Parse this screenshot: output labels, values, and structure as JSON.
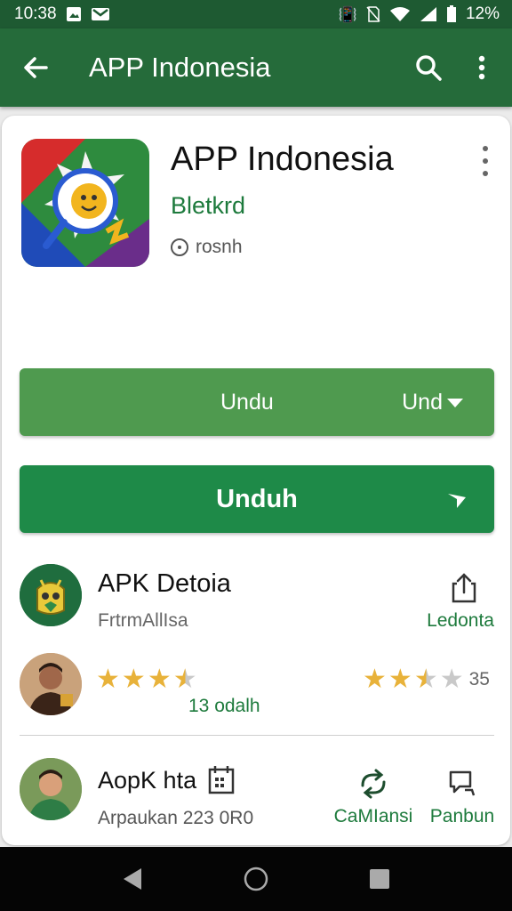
{
  "status": {
    "time": "10:38",
    "battery": "12%",
    "left_icons": [
      "image-notification-icon",
      "gmail-icon"
    ],
    "right_icons": [
      "vibrate-icon",
      "no-sim-icon",
      "wifi-icon",
      "signal-icon",
      "battery-icon"
    ]
  },
  "appbar": {
    "title": "APP Indonesia",
    "icons": [
      "back-arrow-icon",
      "search-icon",
      "more-vert-icon"
    ]
  },
  "app": {
    "title": "APP Indonesia",
    "developer": "Bletkrd",
    "meta": "rosnh"
  },
  "buttons": {
    "primary_label": "Undu",
    "primary_dropdown": "Und",
    "secondary_label": "Unduh"
  },
  "related": {
    "title": "APK Detoia",
    "subtitle": "FrtrmAllIsa",
    "link": "Ledonta"
  },
  "rating": {
    "left_stars": 3.5,
    "right_stars": 2.5,
    "max_stars": 5,
    "count": "35",
    "caption": "13 odalh"
  },
  "bottom": {
    "title": "AopK hta",
    "subtitle": "Arpaukan 223 0R0",
    "action1": "CaMIansi",
    "action2": "Panbun"
  },
  "colors": {
    "status_bar": "#1e5a32",
    "app_bar": "#256b3a",
    "primary_button": "#4f9a4f",
    "secondary_button": "#1e8a48",
    "accent_text": "#1d7a3c",
    "star": "#e8b23a"
  }
}
